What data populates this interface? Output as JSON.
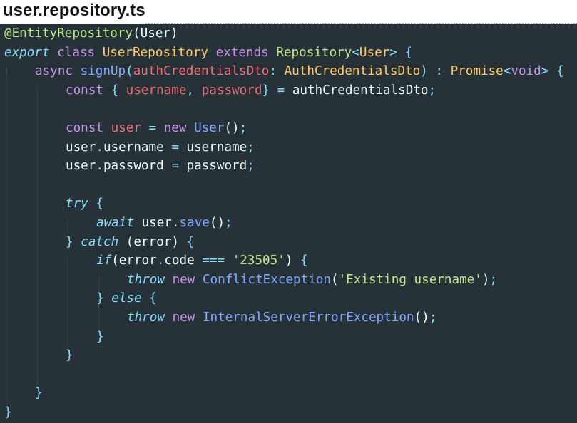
{
  "file": {
    "name": "user.repository.ts"
  },
  "code": {
    "l1": {
      "decorator": "@EntityRepository",
      "open": "(",
      "arg": "User",
      "close": ")"
    },
    "l2": {
      "export": "export",
      "class": "class",
      "name": "UserRepository",
      "extends": "extends",
      "base": "Repository",
      "lt": "<",
      "generic": "User",
      "gt": ">",
      "brace": "{"
    },
    "l3": {
      "async": "async",
      "fn": "signUp",
      "open": "(",
      "param": "authCredentialsDto",
      "colon": ":",
      "type": "AuthCredentialsDto",
      "close": ")",
      "colon2": ":",
      "ret": "Promise",
      "lt": "<",
      "void": "void",
      "gt": ">",
      "brace": "{"
    },
    "l4": {
      "const": "const",
      "lb": "{",
      "a": "username",
      "comma": ",",
      "b": "password",
      "rb": "}",
      "eq": "=",
      "src": "authCredentialsDto",
      "semi": ";"
    },
    "l6": {
      "const": "const",
      "var": "user",
      "eq": "=",
      "new": "new",
      "cls": "User",
      "call": "()",
      "semi": ";"
    },
    "l7": {
      "obj": "user",
      "dot": ".",
      "prop": "username",
      "eq": "=",
      "val": "username",
      "semi": ";"
    },
    "l8": {
      "obj": "user",
      "dot": ".",
      "prop": "password",
      "eq": "=",
      "val": "password",
      "semi": ";"
    },
    "l10": {
      "try": "try",
      "brace": "{"
    },
    "l11": {
      "await": "await",
      "obj": "user",
      "dot": ".",
      "fn": "save",
      "call": "()",
      "semi": ";"
    },
    "l12": {
      "rb": "}",
      "catch": "catch",
      "open": "(",
      "err": "error",
      "close": ")",
      "brace": "{"
    },
    "l13": {
      "if": "if",
      "open": "(",
      "obj": "error",
      "dot": ".",
      "prop": "code",
      "op": "===",
      "str": "'23505'",
      "close": ")",
      "brace": "{"
    },
    "l14": {
      "throw": "throw",
      "new": "new",
      "cls": "ConflictException",
      "open": "(",
      "str": "'Existing username'",
      "close": ")",
      "semi": ";"
    },
    "l15": {
      "rb": "}",
      "else": "else",
      "brace": "{"
    },
    "l16": {
      "throw": "throw",
      "new": "new",
      "cls": "InternalServerErrorException",
      "call": "()",
      "semi": ";"
    },
    "l17": {
      "rb": "}"
    },
    "l18": {
      "rb": "}"
    },
    "l20": {
      "rb": "}"
    },
    "l21": {
      "rb": "}"
    }
  },
  "colors": {
    "background": "#263238",
    "keyword": "#c792ea",
    "italic_keyword": "#89ddff",
    "class": "#ffcb6b",
    "function": "#82aaff",
    "variable": "#f07178",
    "string": "#c3e88d"
  }
}
